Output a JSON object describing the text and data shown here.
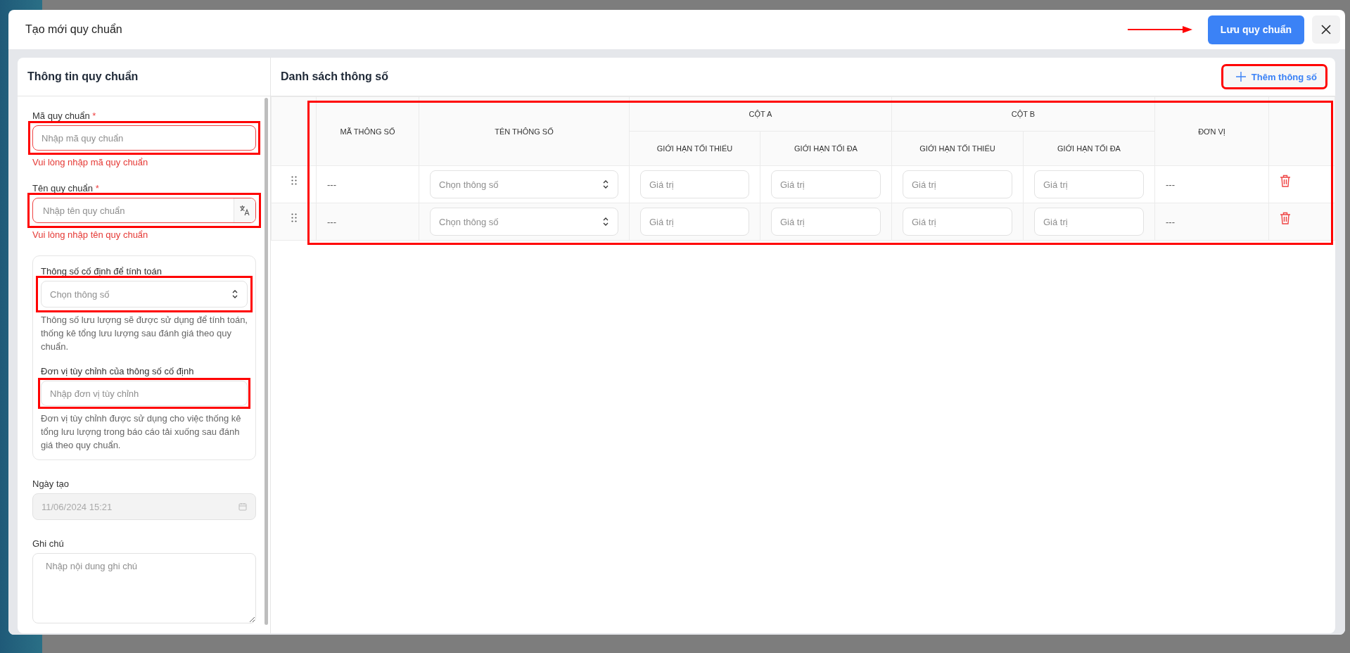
{
  "dialog": {
    "title": "Tạo mới quy chuẩn",
    "save_button": "Lưu quy chuẩn"
  },
  "info_panel": {
    "title": "Thông tin quy chuẩn",
    "code": {
      "label": "Mã quy chuẩn",
      "required_mark": "*",
      "placeholder": "Nhập mã quy chuẩn",
      "invalid": true,
      "error": "Vui lòng nhập mã quy chuẩn"
    },
    "name": {
      "label": "Tên quy chuẩn",
      "required_mark": "*",
      "placeholder": "Nhập tên quy chuẩn",
      "invalid": true,
      "error": "Vui lòng nhập tên quy chuẩn"
    },
    "fixed_group": {
      "param_label": "Thông số cố định để tính toán",
      "param_placeholder": "Chọn thông số",
      "param_help": "Thông số lưu lượng sẽ được sử dụng để tính toán, thống kê tổng lưu lượng sau đánh giá theo quy chuẩn.",
      "unit_label": "Đơn vị tùy chỉnh của thông số cố định",
      "unit_placeholder": "Nhập đơn vị tùy chỉnh",
      "unit_help": "Đơn vị tùy chỉnh được sử dụng cho việc thống kê tổng lưu lượng trong báo cáo tải xuống sau đánh giá theo quy chuẩn."
    },
    "created": {
      "label": "Ngày tạo",
      "value": "11/06/2024 15:21",
      "disabled": true
    },
    "note": {
      "label": "Ghi chú",
      "placeholder": "Nhập nội dung ghi chú"
    }
  },
  "param_panel": {
    "title": "Danh sách thông số",
    "add_button": "Thêm thông số",
    "table": {
      "columns": {
        "code": "MÃ THÔNG SỐ",
        "name": "TÊN THÔNG SỐ",
        "col_a": {
          "label": "CỘT A",
          "min": "GIỚI HẠN TỐI THIỂU",
          "max": "GIỚI HẠN TỐI ĐA"
        },
        "col_b": {
          "label": "CỘT B",
          "min": "GIỚI HẠN TỐI THIỂU",
          "max": "GIỚI HẠN TỐI ĐA"
        },
        "unit": "ĐƠN VỊ"
      },
      "rows": [
        {
          "code": "---",
          "name_placeholder": "Chọn thông số",
          "a_min_placeholder": "Giá trị",
          "a_max_placeholder": "Giá trị",
          "b_min_placeholder": "Giá trị",
          "b_max_placeholder": "Giá trị",
          "unit": "---"
        },
        {
          "code": "---",
          "name_placeholder": "Chọn thông số",
          "a_min_placeholder": "Giá trị",
          "a_max_placeholder": "Giá trị",
          "b_min_placeholder": "Giá trị",
          "b_max_placeholder": "Giá trị",
          "unit": "---"
        }
      ]
    }
  }
}
